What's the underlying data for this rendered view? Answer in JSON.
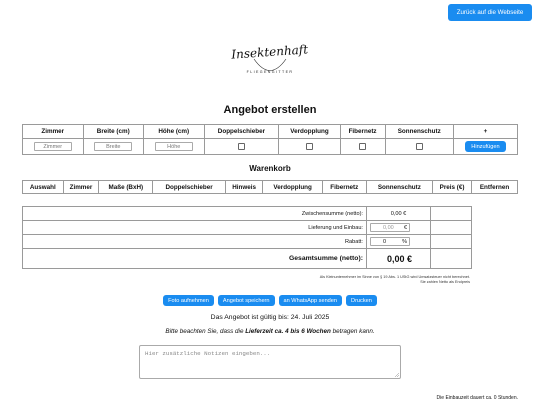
{
  "header": {
    "back_label": "Zurück auf die Webseite"
  },
  "logo": {
    "script_text": "Insektenhaft",
    "ring_text": "FLIEGENGITTER"
  },
  "page_title": "Angebot erstellen",
  "offer_table": {
    "headers": [
      "Zimmer",
      "Breite (cm)",
      "Höhe (cm)",
      "Doppelschieber",
      "Verdopplung",
      "Fibernetz",
      "Sonnenschutz",
      "+"
    ],
    "placeholders": {
      "zimmer": "Zimmer",
      "breite": "Breite",
      "hoehe": "Höhe"
    },
    "add_label": "Hinzufügen"
  },
  "cart": {
    "title": "Warenkorb",
    "headers": [
      "Auswahl",
      "Zimmer",
      "Maße (BxH)",
      "Doppelschieber",
      "Hinweis",
      "Verdopplung",
      "Fibernetz",
      "Sonnenschutz",
      "Preis (€)",
      "Entfernen"
    ]
  },
  "summary": {
    "subtotal_label": "Zwischensumme (netto):",
    "subtotal_value": "0,00 €",
    "delivery_label": "Lieferung und Einbau:",
    "delivery_value": "0,00",
    "delivery_unit": "€",
    "discount_label": "Rabatt:",
    "discount_value": "0",
    "discount_unit": "%",
    "total_label": "Gesamtsumme (netto):",
    "total_value": "0,00 €"
  },
  "tax_note": {
    "line1": "Als Kleinunternehmer im Sinne von § 19 Abs. 1 UStG wird Umsatzsteuer nicht berechnet.",
    "line2": "Sie zahlen Netto als Endpreis"
  },
  "actions": [
    "Foto aufnehmen",
    "Angebot speichern",
    "an WhatsApp senden",
    "Drucken"
  ],
  "validity": {
    "prefix": "Das Angebot ist gültig bis:",
    "date": "24. Juli 2025"
  },
  "delivery_note": {
    "before": "Bitte beachten Sie, dass die ",
    "bold": "Lieferzeit ca. 4 bis 6 Wochen",
    "after": " betragen kann."
  },
  "notes": {
    "placeholder": "Hier zusätzliche Notizen eingeben..."
  },
  "install_time": "Die Einbauzeit dauert ca. 0 Stunden.",
  "colors": {
    "accent": "#1a8cf0",
    "border": "#9a9a9a"
  },
  "icons": {
    "resize": "resize-handle-icon",
    "checkbox": "checkbox-icon"
  }
}
